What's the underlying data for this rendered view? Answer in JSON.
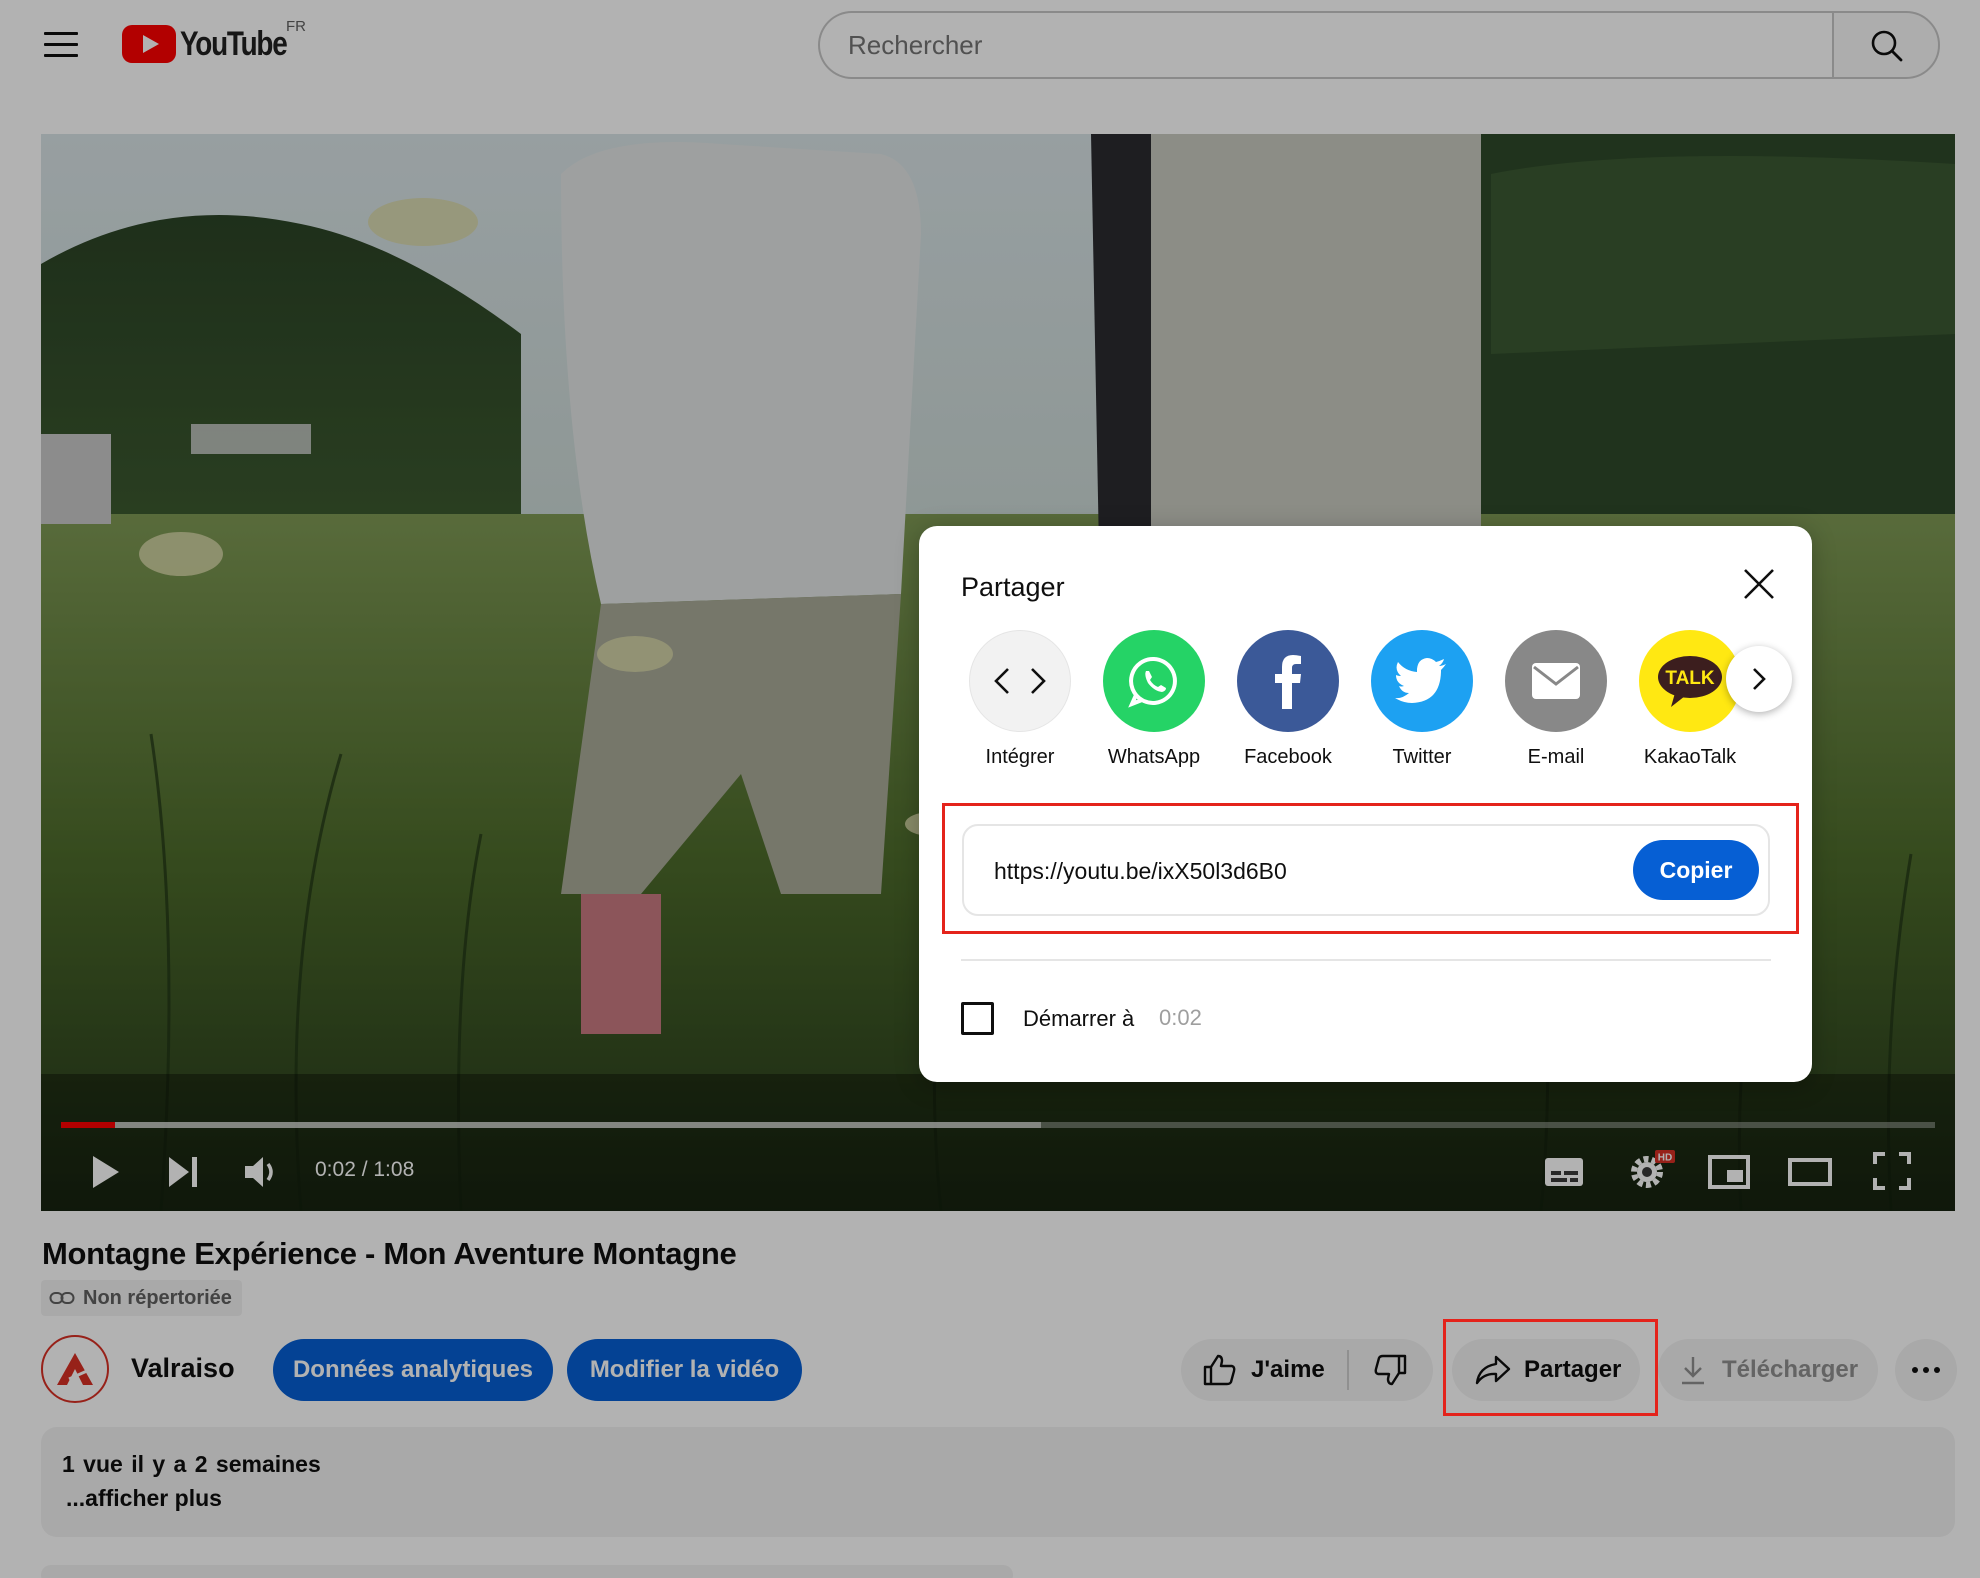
{
  "header": {
    "logo_text": "YouTube",
    "country_code": "FR",
    "search_placeholder": "Rechercher"
  },
  "player": {
    "time_display": "0:02 / 1:08",
    "progress_fraction": 0.029,
    "hd_badge": "HD"
  },
  "video": {
    "title": "Montagne Expérience - Mon Aventure Montagne",
    "visibility_label": "Non répertoriée"
  },
  "channel": {
    "name": "Valraiso"
  },
  "actions": {
    "analytics_label": "Données analytiques",
    "edit_label": "Modifier la vidéo",
    "like_label": "J'aime",
    "share_label": "Partager",
    "download_label": "Télécharger"
  },
  "description": {
    "meta": "1 vue  il y a 2 semaines",
    "more": "...afficher plus"
  },
  "share_dialog": {
    "title": "Partager",
    "targets": [
      {
        "label": "Intégrer",
        "icon": "embed-icon",
        "color": "#f2f2f2"
      },
      {
        "label": "WhatsApp",
        "icon": "whatsapp-icon",
        "color": "#25d366"
      },
      {
        "label": "Facebook",
        "icon": "facebook-icon",
        "color": "#3b5998"
      },
      {
        "label": "Twitter",
        "icon": "twitter-icon",
        "color": "#1da1f2"
      },
      {
        "label": "E-mail",
        "icon": "email-icon",
        "color": "#888888"
      },
      {
        "label": "KakaoTalk",
        "icon": "kakaotalk-icon",
        "color": "#ffe812",
        "badge_text": "TALK"
      }
    ],
    "url": "https://youtu.be/ixX50l3d6B0",
    "copy_label": "Copier",
    "start_at_label": "Démarrer à",
    "start_at_time": "0:02"
  },
  "colors": {
    "accent_blue": "#065fd4",
    "youtube_red": "#ff0000",
    "highlight_red": "#e4231b"
  }
}
